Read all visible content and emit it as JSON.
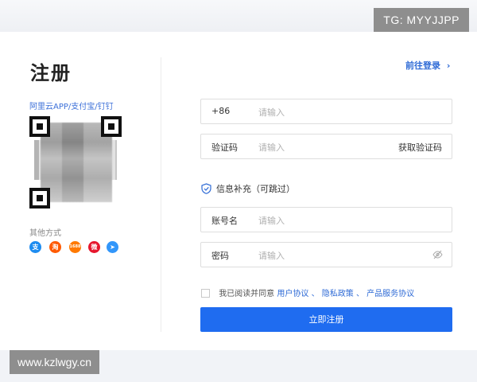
{
  "watermarks": {
    "top": "TG: MYYJJPP",
    "bottom": "www.kzlwgy.cn"
  },
  "page_title": "注册",
  "qr": {
    "caption": "阿里云APP/支付宝/钉钉"
  },
  "other_methods": {
    "label": "其他方式",
    "icons": [
      {
        "name": "alipay-icon",
        "glyph": "支",
        "color": "#1e8cf0"
      },
      {
        "name": "taobao-icon",
        "glyph": "淘",
        "color": "#ff5a00"
      },
      {
        "name": "aliyun-icon",
        "glyph": "1688",
        "color": "#ff7a00"
      },
      {
        "name": "weibo-icon",
        "glyph": "微",
        "color": "#e6162d"
      },
      {
        "name": "dingtalk-icon",
        "glyph": "➤",
        "color": "#3296fa"
      }
    ]
  },
  "login_link": "前往登录",
  "phone": {
    "prefix": "+86",
    "placeholder": "请输入"
  },
  "captcha": {
    "label": "验证码",
    "placeholder": "请输入",
    "action": "获取验证码"
  },
  "info_section": {
    "title": "信息补充（可跳过）"
  },
  "account": {
    "label": "账号名",
    "placeholder": "请输入"
  },
  "password": {
    "label": "密码",
    "placeholder": "请输入"
  },
  "agreement": {
    "prefix": "我已阅读并同意",
    "user_agreement": "用户协议",
    "sep1": "、",
    "privacy": "隐私政策",
    "sep2": "、",
    "service": "产品服务协议"
  },
  "submit_label": "立即注册",
  "colors": {
    "accent": "#1f6cf0",
    "link": "#2f6bd6"
  }
}
